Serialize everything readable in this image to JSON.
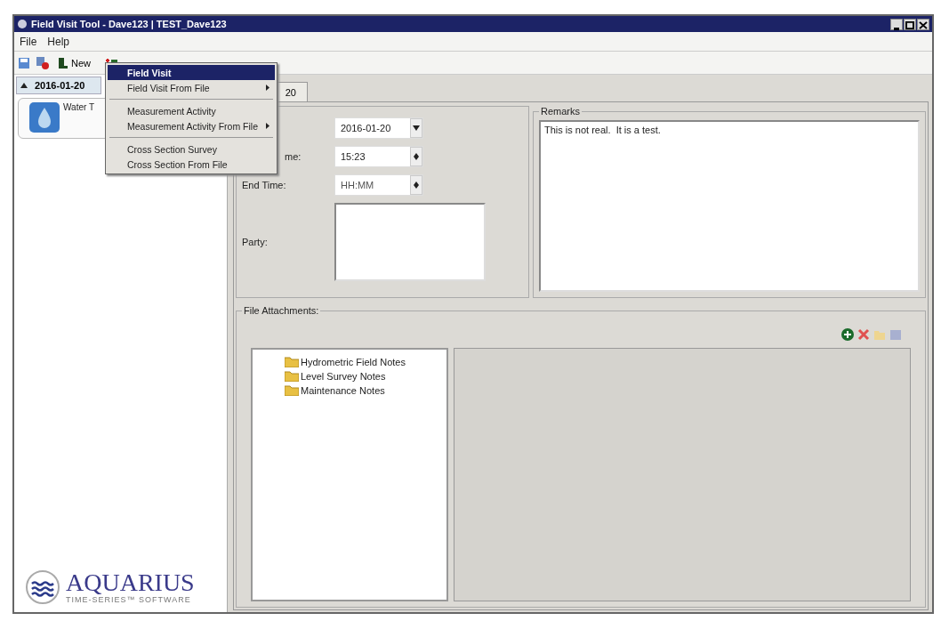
{
  "window": {
    "title": "Field Visit Tool - Dave123 | TEST_Dave123"
  },
  "menu_bar": [
    "File",
    "Help"
  ],
  "toolbar": {
    "new_label": "New"
  },
  "dropdown_menu": [
    [
      {
        "label": "Field Visit",
        "selected": true,
        "submenu": false
      },
      {
        "label": "Field Visit From File",
        "selected": false,
        "submenu": true
      }
    ],
    [
      {
        "label": "Measurement Activity",
        "selected": false,
        "submenu": false
      },
      {
        "label": "Measurement Activity From File",
        "selected": false,
        "submenu": true
      }
    ],
    [
      {
        "label": "Cross Section Survey",
        "selected": false,
        "submenu": false
      },
      {
        "label": "Cross Section From File",
        "selected": false,
        "submenu": false
      }
    ]
  ],
  "visits": [
    {
      "date": "2016-01-20",
      "expanded": true,
      "activities": [
        {
          "label": "Water T"
        }
      ]
    }
  ],
  "tab": {
    "label": "20",
    "selected": true
  },
  "form": [
    {
      "kind": "date",
      "value": "2016-01-20"
    },
    {
      "kind": "time",
      "label": "me:",
      "value": "15:23"
    },
    {
      "kind": "time",
      "label": "End Time:",
      "placeholder": "HH:MM"
    },
    {
      "kind": "textarea",
      "label": "Party:"
    }
  ],
  "remarks": {
    "title": "Remarks",
    "value": "This is not real.  It is a test."
  },
  "attachments": {
    "title": "File Attachments:",
    "folders": [
      "Hydrometric Field Notes",
      "Level Survey Notes",
      "Maintenance Notes"
    ]
  },
  "logo": {
    "name": "AQUARIUS",
    "tagline": "TIME-SERIES™ SOFTWARE"
  }
}
